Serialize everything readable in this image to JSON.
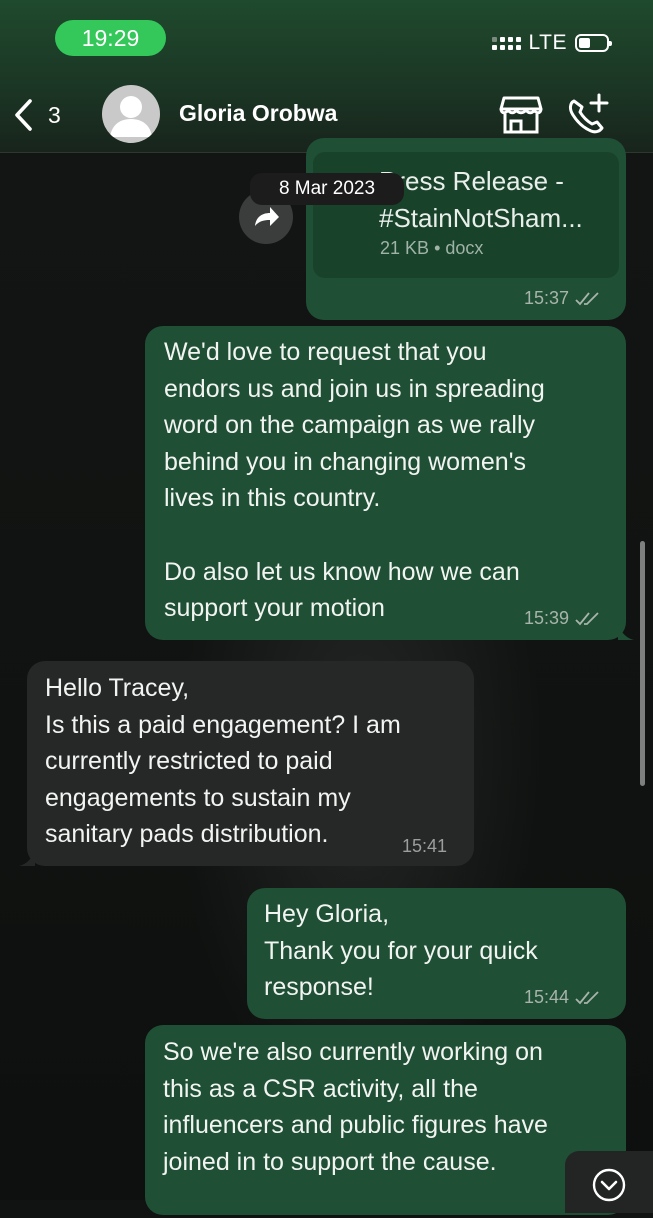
{
  "status_bar": {
    "time": "19:29",
    "network": "LTE",
    "time_pill_color": "#34c759"
  },
  "header": {
    "back_count": "3",
    "contact_name": "Gloria Orobwa",
    "icons": [
      "chevron-left-icon",
      "avatar",
      "store-icon",
      "call-add-icon"
    ]
  },
  "chat": {
    "date_label": "8 Mar 2023",
    "document": {
      "title": "Press Release -\n#StainNotSham...",
      "size": "21 KB",
      "separator": "•",
      "type": "docx",
      "time": "15:37"
    },
    "messages": [
      {
        "direction": "outgoing",
        "text": "We'd love to request that you\nendors us and join us in spreading\nword on the campaign as we rally\nbehind you in changing women's\nlives in this country.\n\nDo also let us know how we can\nsupport your motion",
        "time": "15:39",
        "read": true
      },
      {
        "direction": "incoming",
        "text": "Hello Tracey,\nIs this a paid engagement? I am\ncurrently restricted to paid\nengagements to sustain my\nsanitary pads distribution.",
        "time": "15:41"
      },
      {
        "direction": "outgoing",
        "text": "Hey Gloria,\nThank you for your quick\nresponse!",
        "time": "15:44",
        "read": true
      },
      {
        "direction": "outgoing",
        "text": "So we're also currently working on\nthis as a CSR activity, all the\ninfluencers and public figures have\njoined in to support the cause.",
        "time": "",
        "read": false
      }
    ]
  },
  "colors": {
    "outgoing_bubble": "#1f4f34",
    "incoming_bubble": "#252827",
    "header_green": "#1f4a2d"
  }
}
